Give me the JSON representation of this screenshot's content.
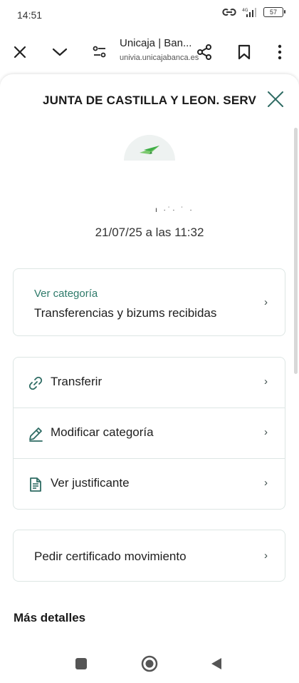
{
  "status_bar": {
    "time": "14:51",
    "battery": "57"
  },
  "browser": {
    "page_title": "Unicaja | Ban...",
    "domain": "univia.unicajabanca.es",
    "icons": [
      "close-icon",
      "chevron-down-icon",
      "page-settings-icon",
      "share-icon",
      "bookmark-icon",
      "more-vert-icon"
    ]
  },
  "movement": {
    "title": "JUNTA DE CASTILLA Y LEON. SERV",
    "amount_masked": "ı ·˙· ˙ ·",
    "date": "21/07/25 a las 11:32",
    "logo_icon": "paper-plane-logo",
    "accent_color": "#2e7a6a"
  },
  "category": {
    "label": "Ver categoría",
    "value": "Transferencias y bizums recibidas"
  },
  "actions": [
    {
      "label": "Transferir",
      "icon": "link-icon"
    },
    {
      "label": "Modificar categoría",
      "icon": "pencil-icon"
    },
    {
      "label": "Ver justificante",
      "icon": "document-icon"
    }
  ],
  "certificate": {
    "label": "Pedir certificado movimiento"
  },
  "details": {
    "title": "Más detalles"
  },
  "nav": {
    "icons": [
      "recents-square-icon",
      "home-circle-icon",
      "back-triangle-icon"
    ]
  }
}
